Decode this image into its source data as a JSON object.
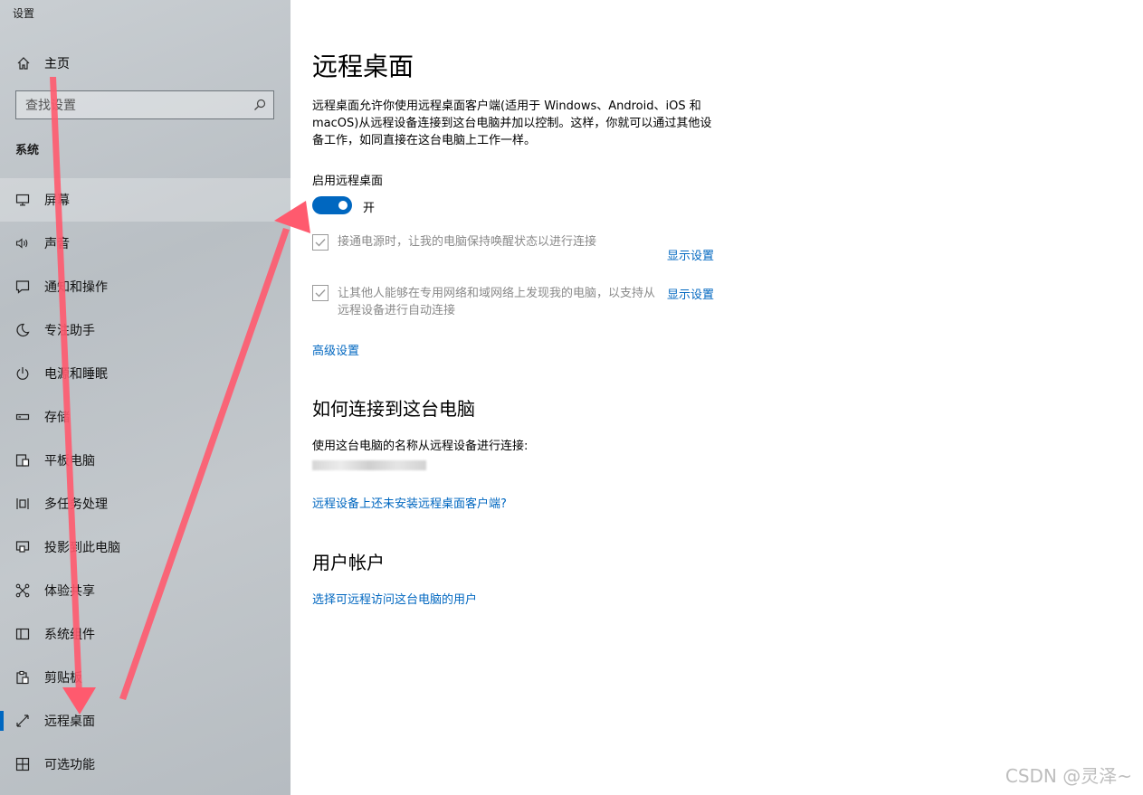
{
  "app_title": "设置",
  "sidebar": {
    "home_label": "主页",
    "search_placeholder": "查找设置",
    "section_title": "系统",
    "items": [
      {
        "label": "屏幕",
        "icon": "monitor-icon"
      },
      {
        "label": "声音",
        "icon": "speaker-icon"
      },
      {
        "label": "通知和操作",
        "icon": "notification-icon"
      },
      {
        "label": "专注助手",
        "icon": "moon-icon"
      },
      {
        "label": "电源和睡眠",
        "icon": "power-icon"
      },
      {
        "label": "存储",
        "icon": "storage-icon"
      },
      {
        "label": "平板电脑",
        "icon": "tablet-icon"
      },
      {
        "label": "多任务处理",
        "icon": "multitasking-icon"
      },
      {
        "label": "投影到此电脑",
        "icon": "project-icon"
      },
      {
        "label": "体验共享",
        "icon": "share-icon"
      },
      {
        "label": "系统组件",
        "icon": "components-icon"
      },
      {
        "label": "剪贴板",
        "icon": "clipboard-icon"
      },
      {
        "label": "远程桌面",
        "icon": "remote-desktop-icon"
      },
      {
        "label": "可选功能",
        "icon": "optional-features-icon"
      }
    ],
    "active_item": "远程桌面"
  },
  "main": {
    "title": "远程桌面",
    "description": "远程桌面允许你使用远程桌面客户端(适用于 Windows、Android、iOS 和 macOS)从远程设备连接到这台电脑并加以控制。这样，你就可以通过其他设备工作，如同直接在这台电脑上工作一样。",
    "enable_label": "启用远程桌面",
    "toggle_state": "开",
    "toggle_on": true,
    "option1_label": "接通电源时，让我的电脑保持唤醒状态以进行连接",
    "option1_link": "显示设置",
    "option2_label": "让其他人能够在专用网络和域网络上发现我的电脑，以支持从远程设备进行自动连接",
    "option2_link": "显示设置",
    "advanced_link": "高级设置",
    "connect_heading": "如何连接到这台电脑",
    "connect_text": "使用这台电脑的名称从远程设备进行连接:",
    "client_link": "远程设备上还未安装远程桌面客户端?",
    "accounts_heading": "用户帐户",
    "accounts_link": "选择可远程访问这台电脑的用户"
  },
  "watermark": "CSDN @灵泽~",
  "colors": {
    "accent": "#0067c0",
    "arrow": "#ff5a6e"
  }
}
